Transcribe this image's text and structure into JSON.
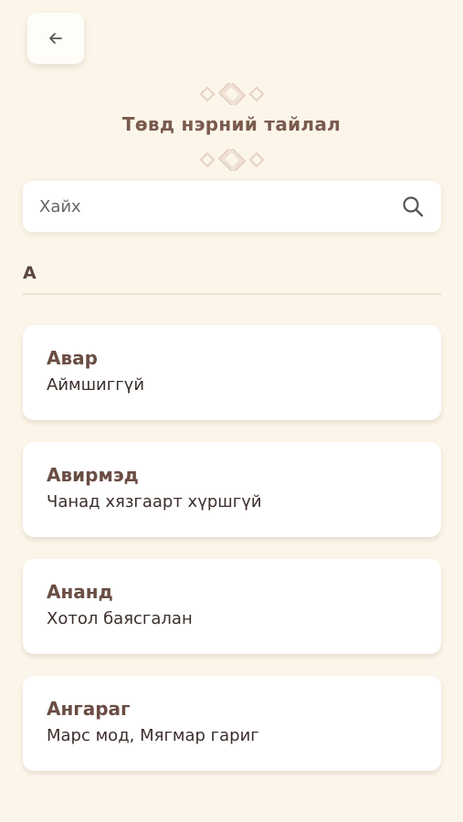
{
  "header": {
    "back_icon": "arrow-left-icon",
    "title": "Төвд нэрний тайлал"
  },
  "search": {
    "placeholder": "Хайх",
    "icon": "search-icon"
  },
  "section": {
    "letter": "А"
  },
  "names": [
    {
      "name": "Авар",
      "meaning": "Аймшиггүй"
    },
    {
      "name": "Авирмэд",
      "meaning": "Чанад хязгаарт хүршгүй"
    },
    {
      "name": "Ананд",
      "meaning": "Хотол баясгалан"
    },
    {
      "name": "Ангараг",
      "meaning": "Марс мод, Мягмар гариг"
    }
  ],
  "colors": {
    "background": "#fcf6ea",
    "title": "#7a5b4e",
    "ornament": "#e8d6c6"
  }
}
